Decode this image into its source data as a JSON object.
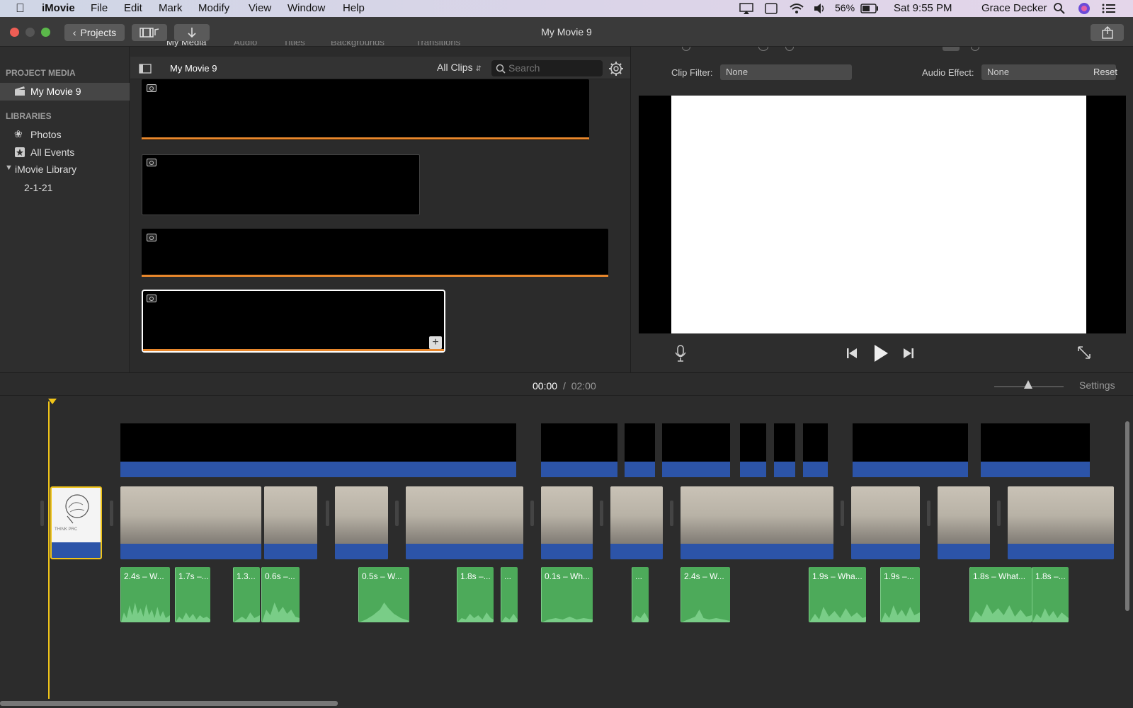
{
  "menubar": {
    "app": "iMovie",
    "items": [
      "File",
      "Edit",
      "Mark",
      "Modify",
      "View",
      "Window",
      "Help"
    ],
    "battery": "56%",
    "clock": "Sat 9:55 PM",
    "user": "Grace Decker"
  },
  "window": {
    "title": "My Movie 9",
    "projects_label": "Projects"
  },
  "browser_tabs": [
    "My Media",
    "Audio",
    "Titles",
    "Backgrounds",
    "Transitions"
  ],
  "sidebar": {
    "project_media_header": "PROJECT MEDIA",
    "project": "My Movie 9",
    "libraries_header": "LIBRARIES",
    "photos": "Photos",
    "all_events": "All Events",
    "library": "iMovie Library",
    "event": "2-1-21"
  },
  "browser": {
    "title": "My Movie 9",
    "filter": "All Clips",
    "search_placeholder": "Search"
  },
  "viewer": {
    "clip_filter_label": "Clip Filter:",
    "clip_filter_value": "None",
    "audio_effect_label": "Audio Effect:",
    "audio_effect_value": "None",
    "reset_label": "Reset"
  },
  "timeline": {
    "current_time": "00:00",
    "separator": "/",
    "total_time": "02:00",
    "settings_label": "Settings",
    "title_clip_text": "THINK PRC"
  },
  "audio_labels": [
    "2.4s – W...",
    "1.7s –...",
    "1.3...",
    "0.6s –...",
    "0.5s – W...",
    "1.8s –...",
    "...",
    "0.1s – Wh...",
    "...",
    "2.4s – W...",
    "1.9s – Wha...",
    "1.9s –...",
    "1.8s – What...",
    "1.8s –..."
  ],
  "colors": {
    "accent_orange": "#e8872c",
    "clip_blue": "#2c54a8",
    "audio_green": "#4daa5a",
    "playhead": "#f0c419"
  }
}
